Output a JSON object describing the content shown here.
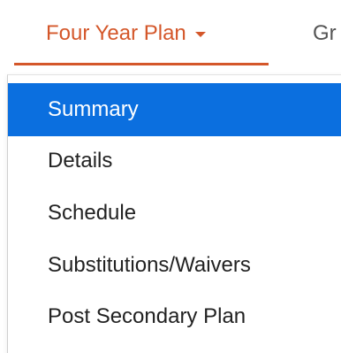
{
  "nav": {
    "active_tab": "Four Year Plan",
    "next_tab": "Gr"
  },
  "dropdown": {
    "items": [
      {
        "label": "Summary"
      },
      {
        "label": "Details"
      },
      {
        "label": "Schedule"
      },
      {
        "label": "Substitutions/Waivers"
      },
      {
        "label": "Post Secondary Plan"
      }
    ],
    "selected_index": 0
  },
  "colors": {
    "accent": "#d4572a",
    "selection": "#0b6fdf",
    "text": "#222222",
    "muted_text": "#555555"
  },
  "icons": {
    "active_tab_caret": "caret-down-icon"
  }
}
